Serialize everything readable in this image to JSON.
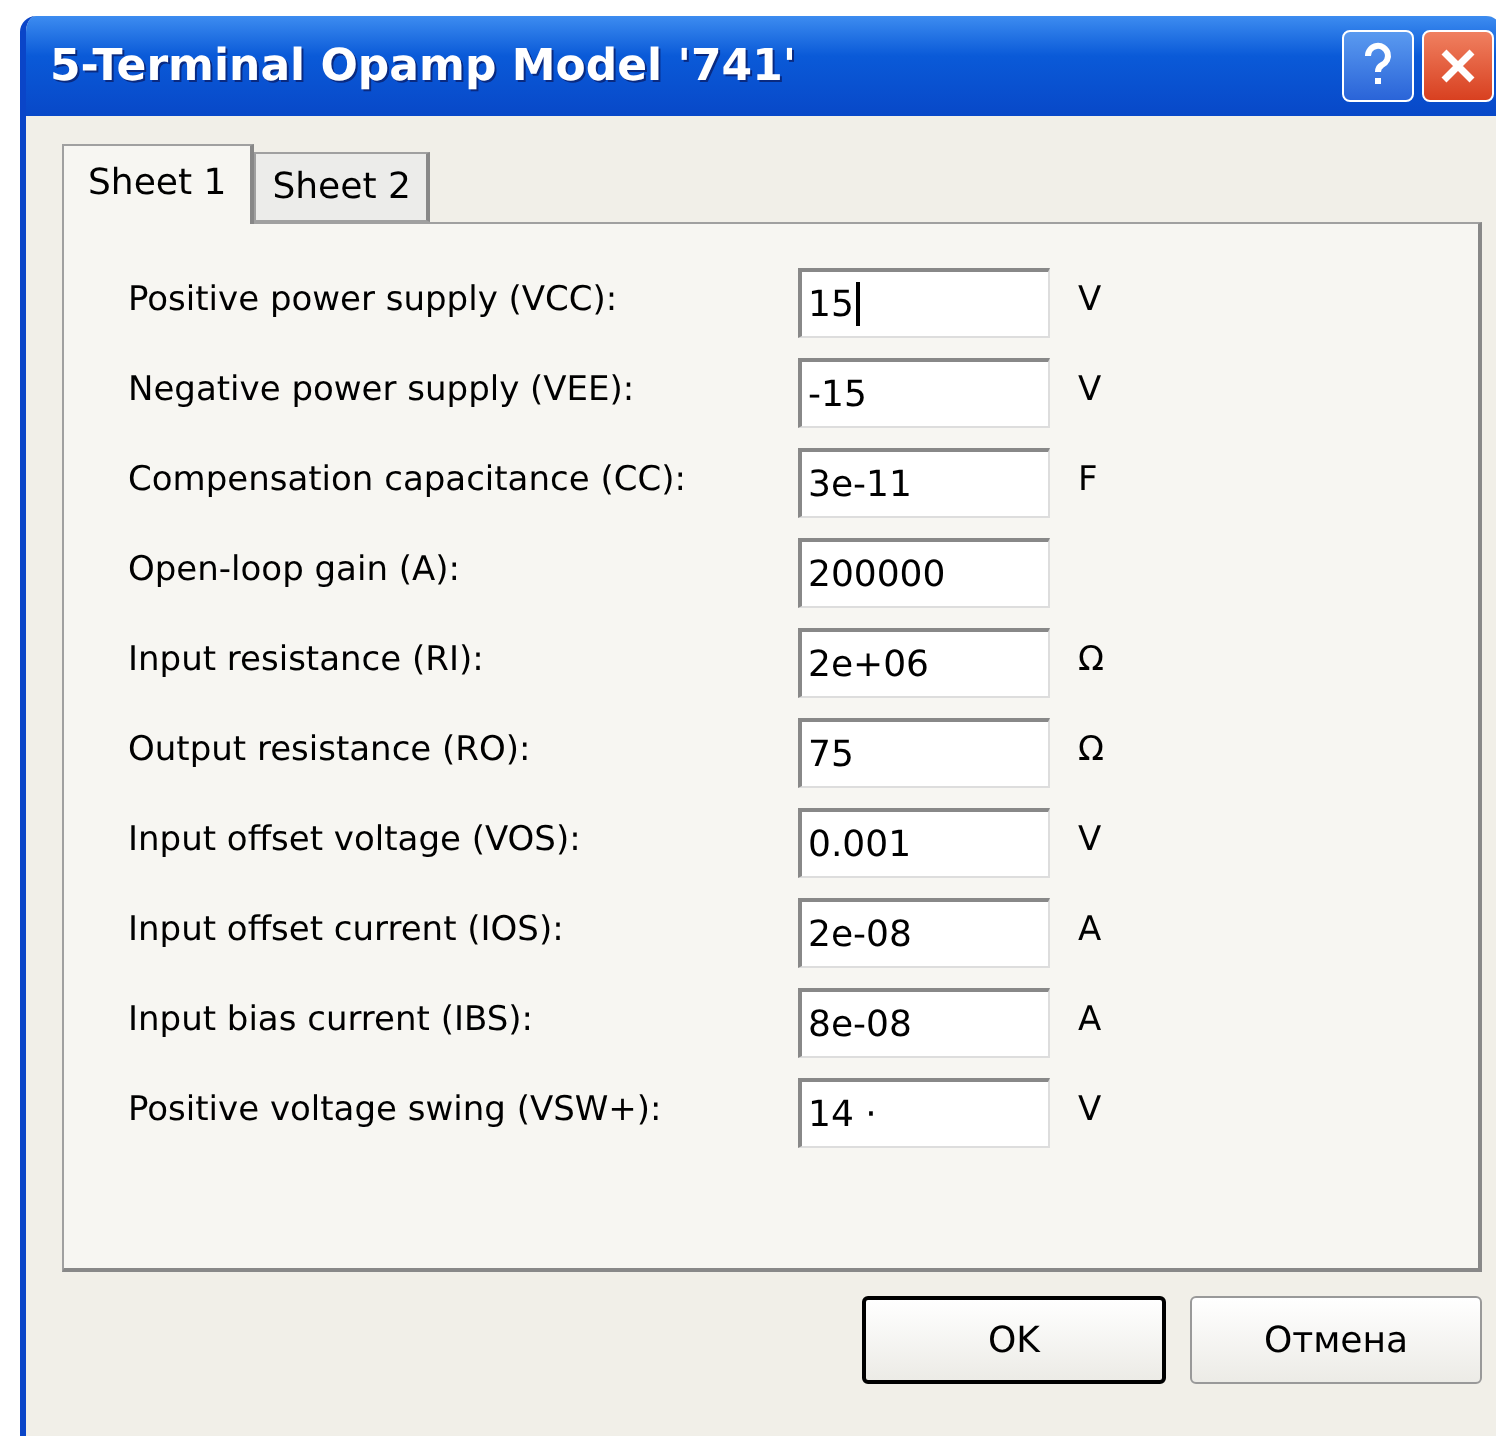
{
  "window": {
    "title": "5-Terminal Opamp Model '741'"
  },
  "tabs": [
    {
      "label": "Sheet 1",
      "selected": true
    },
    {
      "label": "Sheet 2",
      "selected": false
    }
  ],
  "rows": [
    {
      "label": "Positive power supply (VCC):",
      "value": "15",
      "unit": "V",
      "focused": true
    },
    {
      "label": "Negative power supply (VEE):",
      "value": "-15",
      "unit": "V",
      "focused": false
    },
    {
      "label": "Compensation capacitance (CC):",
      "value": "3e-11",
      "unit": "F",
      "focused": false
    },
    {
      "label": "Open-loop gain (A):",
      "value": "200000",
      "focused": false
    },
    {
      "label": "Input resistance (RI):",
      "value": "2e+06",
      "unit": "Ω",
      "focused": false
    },
    {
      "label": "Output resistance (RO):",
      "value": "75",
      "unit": "Ω",
      "focused": false
    },
    {
      "label": "Input offset voltage (VOS):",
      "value": "0.001",
      "unit": "V",
      "focused": false
    },
    {
      "label": "Input offset current (IOS):",
      "value": "2e-08",
      "unit": "A",
      "focused": false
    },
    {
      "label": "Input bias current (IBS):",
      "value": "8e-08",
      "unit": "A",
      "focused": false
    },
    {
      "label": "Positive voltage swing (VSW+):",
      "value": "14 ·",
      "unit": "V",
      "focused": false
    }
  ],
  "buttons": [
    {
      "label": "OK",
      "default": true
    },
    {
      "label": "Отмена",
      "default": false
    }
  ]
}
